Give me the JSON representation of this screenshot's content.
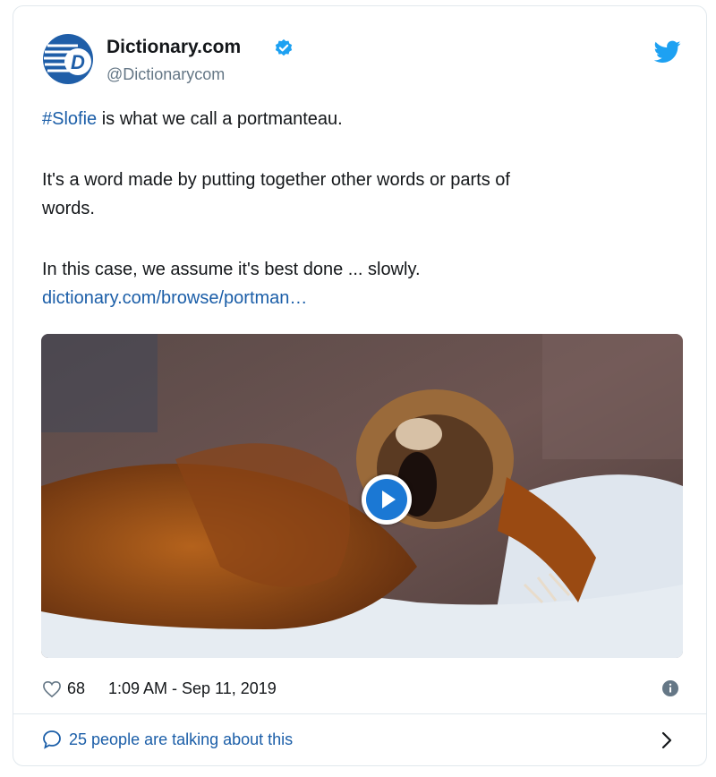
{
  "author": {
    "name": "Dictionary.com",
    "handle": "@Dictionarycom"
  },
  "tweet": {
    "hashtag": "#Slofie",
    "line1_rest": " is what we call a portmanteau.",
    "line2a": "It's a word made by putting together other words or parts of",
    "line2b": "words.",
    "line3": "In this case, we assume it's best done ... slowly.",
    "link": "dictionary.com/browse/portman…"
  },
  "footer": {
    "likes": "68",
    "timestamp": "1:09 AM - Sep 11, 2019",
    "talking": "25 people are talking about this"
  },
  "colors": {
    "link": "#1b5ea8",
    "twitter_blue": "#1da1f2",
    "verified": "#1da1f2"
  },
  "icons": [
    "dictionary-logo-icon",
    "verified-badge-icon",
    "twitter-bird-icon",
    "play-icon",
    "heart-icon",
    "info-icon",
    "speech-bubble-icon",
    "chevron-right-icon"
  ]
}
